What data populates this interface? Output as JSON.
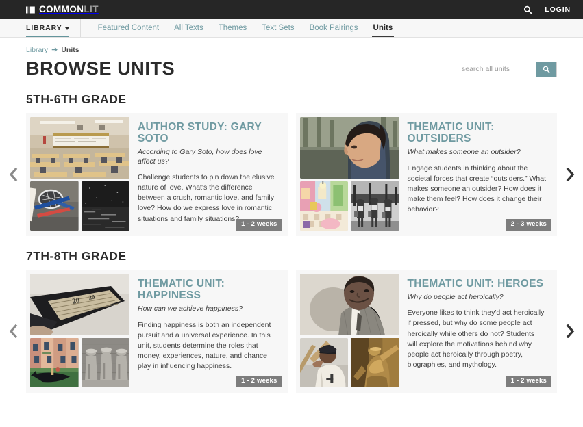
{
  "header": {
    "logo_common": "COMMON",
    "logo_lit": "LIT",
    "logo_icon": "book-icon",
    "search_icon": "search-icon",
    "login_label": "LOGIN"
  },
  "nav": {
    "library_label": "LIBRARY",
    "caret_icon": "chevron-down-icon",
    "items": [
      {
        "label": "Featured Content",
        "active": false
      },
      {
        "label": "All Texts",
        "active": false
      },
      {
        "label": "Themes",
        "active": false
      },
      {
        "label": "Text Sets",
        "active": false
      },
      {
        "label": "Book Pairings",
        "active": false
      },
      {
        "label": "Units",
        "active": true
      }
    ]
  },
  "breadcrumb": {
    "root": "Library",
    "arrow": "➔",
    "current": "Units"
  },
  "page": {
    "title": "BROWSE UNITS"
  },
  "search": {
    "placeholder": "search all units",
    "value": "",
    "button_icon": "search-icon"
  },
  "carousel": {
    "prev_icon": "chevron-left-icon",
    "next_icon": "chevron-right-icon"
  },
  "sections": [
    {
      "title": "5TH-6TH GRADE",
      "units": [
        {
          "title": "AUTHOR STUDY: GARY SOTO",
          "question": "According to Gary Soto, how does love affect us?",
          "description": "Challenge students to pin down the elusive nature of love. What's the difference between a crush, romantic love, and family love? How do we express love in romantic situations and family situations?",
          "duration": "1 - 2 weeks",
          "images": [
            "classroom-photo",
            "tennis-rackets-photo",
            "dark-water-photo"
          ]
        },
        {
          "title": "THEMATIC UNIT: OUTSIDERS",
          "question": "What makes someone an outsider?",
          "description": "Engage students in thinking about the societal forces that create “outsiders.” What makes someone an outsider? How does it make them feel? How does it change their behavior?",
          "duration": "2 - 3 weeks",
          "images": [
            "boy-profile-photo",
            "colorful-room-photo",
            "marching-group-photo"
          ]
        }
      ]
    },
    {
      "title": "7TH-8TH GRADE",
      "units": [
        {
          "title": "THEMATIC UNIT: HAPPINESS",
          "question": "How can we achieve happiness?",
          "description": "Finding happiness is both an independent pursuit and a universal experience. In this unit, students determine the roles that money, experiences, nature, and chance play in influencing happiness.",
          "duration": "1 - 2 weeks",
          "images": [
            "wallet-money-photo",
            "venice-gondola-photo",
            "statues-photo"
          ]
        },
        {
          "title": "THEMATIC UNIT: HEROES",
          "question": "Why do people act heroically?",
          "description": "Everyone likes to think they'd act heroically if pressed, but why do some people act heroically while others do not? Students will explore the motivations behind why people act heroically through poetry, biographies, and mythology.",
          "duration": "1 - 2 weeks",
          "images": [
            "portrait-man-photo",
            "baseball-batter-photo",
            "bronze-statue-photo"
          ]
        }
      ]
    }
  ],
  "colors": {
    "accent_teal": "#6f9aa1",
    "dark": "#262626",
    "badge_gray": "#7d7d7d"
  }
}
